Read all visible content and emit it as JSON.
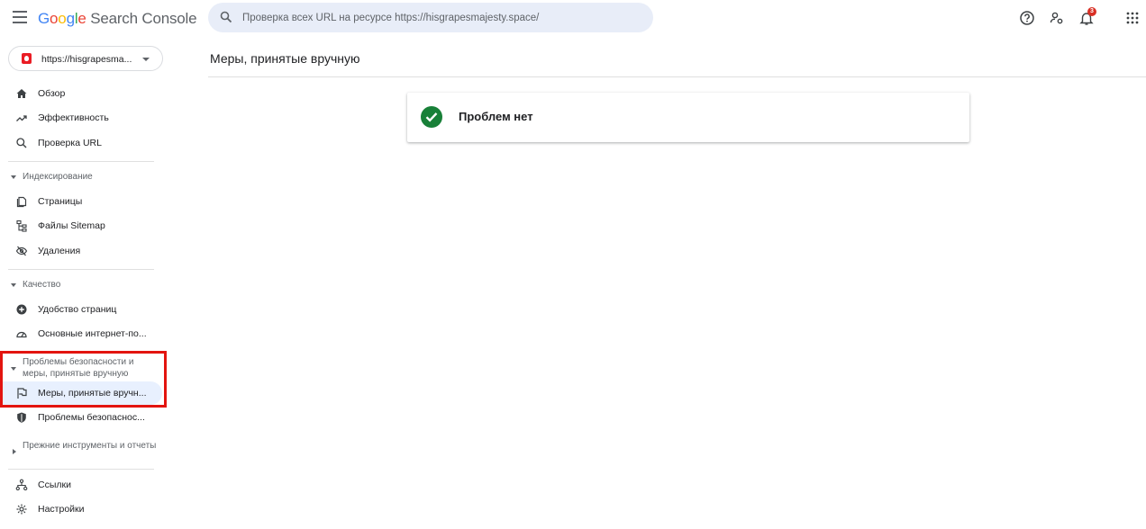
{
  "header": {
    "logo_brand": [
      "G",
      "o",
      "o",
      "g",
      "l",
      "e"
    ],
    "logo_rest": "Search Console",
    "search_placeholder": "Проверка всех URL на ресурсе https://hisgrapesmajesty.space/",
    "notifications_count": "3",
    "icons": [
      "menu-icon",
      "search-icon",
      "help-icon",
      "account-settings-icon",
      "bell-icon",
      "apps-grid-icon"
    ]
  },
  "sidebar": {
    "property": "https://hisgrapesma...",
    "items": {
      "overview": "Обзор",
      "performance": "Эффективность",
      "url_inspection": "Проверка URL",
      "indexing_section": "Индексирование",
      "pages": "Страницы",
      "sitemaps": "Файлы Sitemap",
      "removals": "Удаления",
      "quality_section": "Качество",
      "page_experience": "Удобство страниц",
      "core_web_vitals": "Основные интернет-по...",
      "security_section": "Проблемы безопасности и меры, принятые вручную",
      "manual_actions": "Меры, принятые вручн...",
      "security_issues": "Проблемы безопаснос...",
      "legacy_section": "Прежние инструменты и отчеты",
      "links": "Ссылки",
      "settings": "Настройки"
    }
  },
  "main": {
    "title": "Меры, принятые вручную",
    "status_text": "Проблем нет"
  },
  "colors": {
    "accent_blue": "#4285f4",
    "success_green": "#188038",
    "highlight_red": "#e3140f",
    "active_bg": "#e8f0fe",
    "search_bg": "#e8edf8"
  }
}
